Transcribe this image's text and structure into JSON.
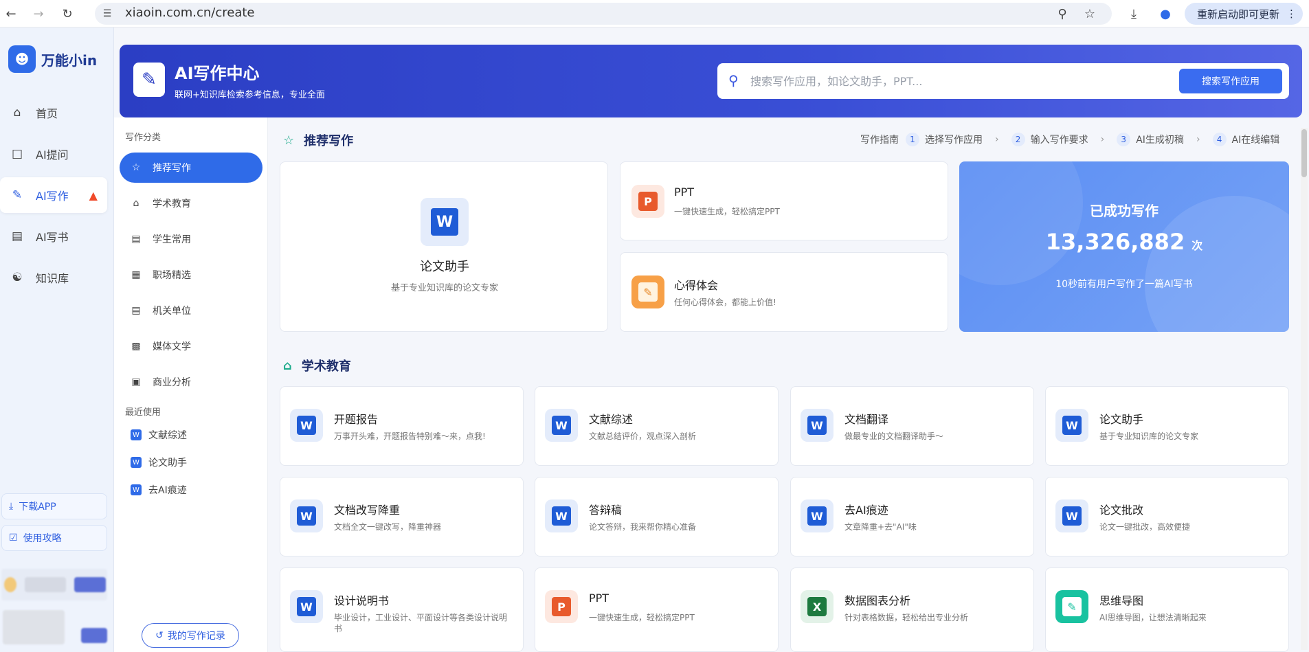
{
  "browser": {
    "url": "xiaoin.com.cn/create",
    "update_label": "重新启动即可更新"
  },
  "sidebar": {
    "brand": "万能小in",
    "items": [
      {
        "label": "首页",
        "icon": "home-icon"
      },
      {
        "label": "AI提问",
        "icon": "chat-icon"
      },
      {
        "label": "AI写作",
        "icon": "pen-icon"
      },
      {
        "label": "AI写书",
        "icon": "book-icon"
      },
      {
        "label": "知识库",
        "icon": "brain-icon"
      }
    ],
    "download_label": "下载APP",
    "guide_label": "使用攻略"
  },
  "header": {
    "title": "AI写作中心",
    "subtitle": "联网+知识库检索参考信息，专业全面",
    "search_placeholder": "搜索写作应用，如论文助手，PPT...",
    "search_button": "搜索写作应用"
  },
  "categories": {
    "heading": "写作分类",
    "items": [
      {
        "label": "推荐写作"
      },
      {
        "label": "学术教育"
      },
      {
        "label": "学生常用"
      },
      {
        "label": "职场精选"
      },
      {
        "label": "机关单位"
      },
      {
        "label": "媒体文学"
      },
      {
        "label": "商业分析"
      }
    ],
    "recent_heading": "最近使用",
    "recent": [
      {
        "label": "文献综述"
      },
      {
        "label": "论文助手"
      },
      {
        "label": "去AI痕迹"
      }
    ],
    "history_button": "我的写作记录"
  },
  "recommend": {
    "title": "推荐写作",
    "guide_label": "写作指南",
    "steps": [
      {
        "num": "1",
        "label": "选择写作应用"
      },
      {
        "num": "2",
        "label": "输入写作要求"
      },
      {
        "num": "3",
        "label": "AI生成初稿"
      },
      {
        "num": "4",
        "label": "AI在线编辑"
      }
    ],
    "big_card": {
      "title": "论文助手",
      "desc": "基于专业知识库的论文专家"
    },
    "ppt_card": {
      "title": "PPT",
      "desc": "一键快速生成，轻松搞定PPT"
    },
    "xinde_card": {
      "title": "心得体会",
      "desc": "任何心得体会，都能上价值!"
    },
    "stats": {
      "title": "已成功写作",
      "number": "13,326,882",
      "unit": "次",
      "note": "10秒前有用户写作了一篇AI写书"
    }
  },
  "academic": {
    "title": "学术教育",
    "cards": [
      {
        "title": "开题报告",
        "desc": "万事开头难，开题报告特别难～来，点我!",
        "icon": "word"
      },
      {
        "title": "文献综述",
        "desc": "文献总结评价，观点深入剖析",
        "icon": "word"
      },
      {
        "title": "文档翻译",
        "desc": "做最专业的文档翻译助手～",
        "icon": "word"
      },
      {
        "title": "论文助手",
        "desc": "基于专业知识库的论文专家",
        "icon": "word"
      },
      {
        "title": "文档改写降重",
        "desc": "文档全文一键改写，降重神器",
        "icon": "word"
      },
      {
        "title": "答辩稿",
        "desc": "论文答辩，我来帮你精心准备",
        "icon": "word"
      },
      {
        "title": "去AI痕迹",
        "desc": "文章降重+去\"AI\"味",
        "icon": "word"
      },
      {
        "title": "论文批改",
        "desc": "论文一键批改，高效便捷",
        "icon": "word"
      },
      {
        "title": "设计说明书",
        "desc": "毕业设计，工业设计、平面设计等各类设计说明书",
        "icon": "word"
      },
      {
        "title": "PPT",
        "desc": "一键快速生成，轻松搞定PPT",
        "icon": "ppt"
      },
      {
        "title": "数据图表分析",
        "desc": "针对表格数据，轻松给出专业分析",
        "icon": "excel"
      },
      {
        "title": "思维导图",
        "desc": "AI思维导图，让想法清晰起来",
        "icon": "mindmap"
      }
    ]
  }
}
